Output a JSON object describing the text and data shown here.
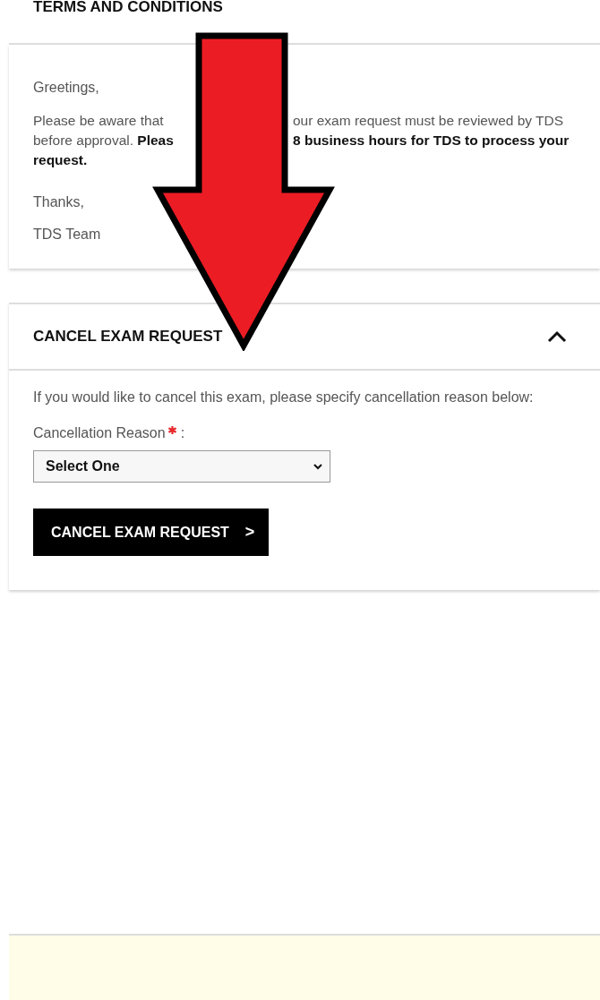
{
  "terms": {
    "title": "TERMS AND CONDITIONS",
    "greeting": "Greetings,",
    "message_lines": [
      {
        "left": "Please be aware that",
        "right": "our exam request must be reviewed by TDS"
      },
      {
        "left": "before approval. **Pleas**",
        "right": "**8 business hours for TDS to process your**"
      },
      {
        "left": "**request.**"
      }
    ],
    "thanks": "Thanks,",
    "signature": "TDS Team"
  },
  "cancel": {
    "title": "CANCEL EXAM REQUEST",
    "expanded": true,
    "intro": "If you would like to cancel this exam, please specify cancellation reason below:",
    "reason_label": "Cancellation Reason",
    "required": true,
    "label_suffix": ":",
    "select_value": "Select One",
    "button": "CANCEL EXAM REQUEST",
    "button_icon": ">"
  }
}
